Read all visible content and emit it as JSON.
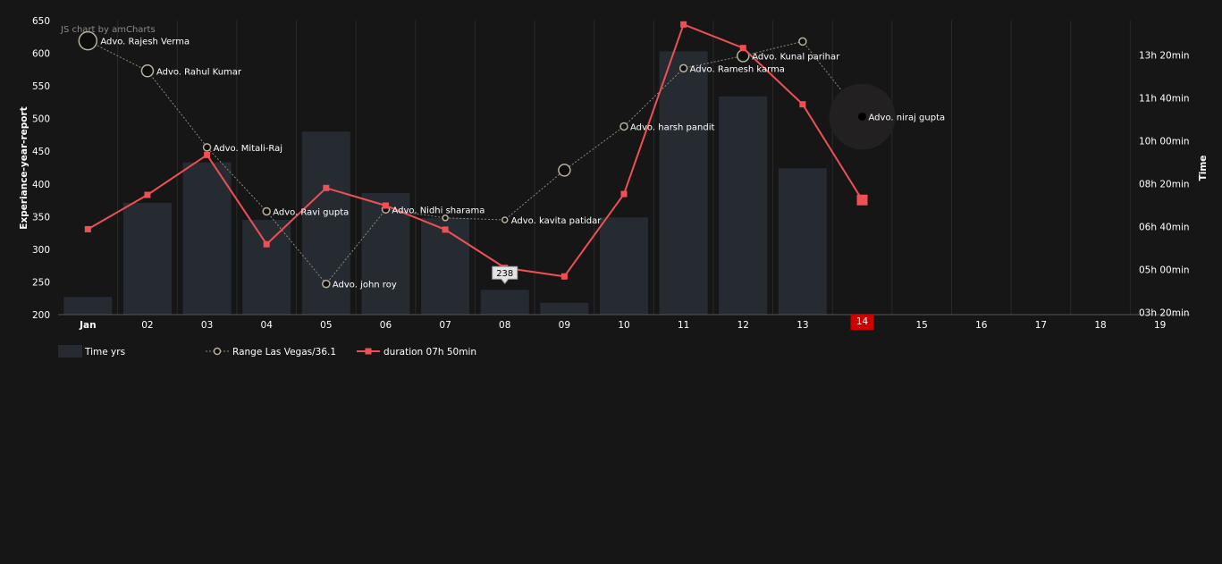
{
  "credit": "JS chart by amCharts",
  "chart_data": {
    "type": "bar",
    "categories": [
      "Jan",
      "02",
      "03",
      "04",
      "05",
      "06",
      "07",
      "08",
      "09",
      "10",
      "11",
      "12",
      "13",
      "14",
      "15",
      "16",
      "17",
      "18",
      "19"
    ],
    "bold_category": "Jan",
    "highlighted_category": "14",
    "highlight_color": "#cc0000",
    "y_left": {
      "label": "Experiance-year-report",
      "ticks": [
        "200",
        "250",
        "300",
        "350",
        "400",
        "450",
        "500",
        "550",
        "600",
        "650"
      ],
      "ylim": [
        200,
        650
      ]
    },
    "y_right": {
      "label": "Time",
      "ticks": [
        "03h 20min",
        "05h 00min",
        "06h 40min",
        "08h 20min",
        "10h 00min",
        "11h 40min",
        "13h 20min"
      ],
      "tick_minutes": [
        200,
        300,
        400,
        500,
        600,
        700,
        800
      ],
      "ylim_minutes": [
        195,
        880
      ]
    },
    "bars": {
      "name": "Time  yrs",
      "color": "#262b31",
      "values": [
        227,
        371,
        433,
        345,
        480,
        386,
        348,
        238,
        218,
        349,
        603,
        534,
        424,
        null,
        null,
        null,
        null,
        null,
        null
      ]
    },
    "range_line": {
      "name": "Range  Las Vegas/36.1",
      "color": "#8a8a7a",
      "points": [
        {
          "value": 619,
          "label": "Advo. Rajesh Verma",
          "size": "large"
        },
        {
          "value": 573,
          "label": "Advo. Rahul Kumar",
          "size": "medium"
        },
        {
          "value": 456,
          "label": "Advo. Mitali-Raj",
          "size": "small"
        },
        {
          "value": 358,
          "label": "Advo. Ravi gupta",
          "size": "small"
        },
        {
          "value": 247,
          "label": "Advo. john roy",
          "size": "small"
        },
        {
          "value": 361,
          "label": "Advo. Nidhi sharama",
          "size": "small"
        },
        {
          "value": 348,
          "label": "",
          "size": "tiny"
        },
        {
          "value": 345,
          "label": "Advo. kavita patidar",
          "size": "tiny"
        },
        {
          "value": 421,
          "label": "",
          "size": "medium"
        },
        {
          "value": 488,
          "label": "Advo. harsh pandit",
          "size": "small"
        },
        {
          "value": 577,
          "label": "Advo. Ramesh karma",
          "size": "small"
        },
        {
          "value": 596,
          "label": "Advo. Kunal parihar",
          "size": "medium"
        },
        {
          "value": 618,
          "label": "",
          "size": "small"
        },
        {
          "value": 503,
          "label": "Advo. niraj gupta",
          "size": "halo"
        }
      ]
    },
    "duration_line": {
      "name": "duration 07h 50min",
      "color": "#ee5055",
      "minutes": [
        394,
        474,
        567,
        359,
        490,
        449,
        393,
        304,
        284,
        476,
        871,
        816,
        685,
        462
      ]
    },
    "balloon": {
      "category": "08",
      "text": "238"
    }
  }
}
